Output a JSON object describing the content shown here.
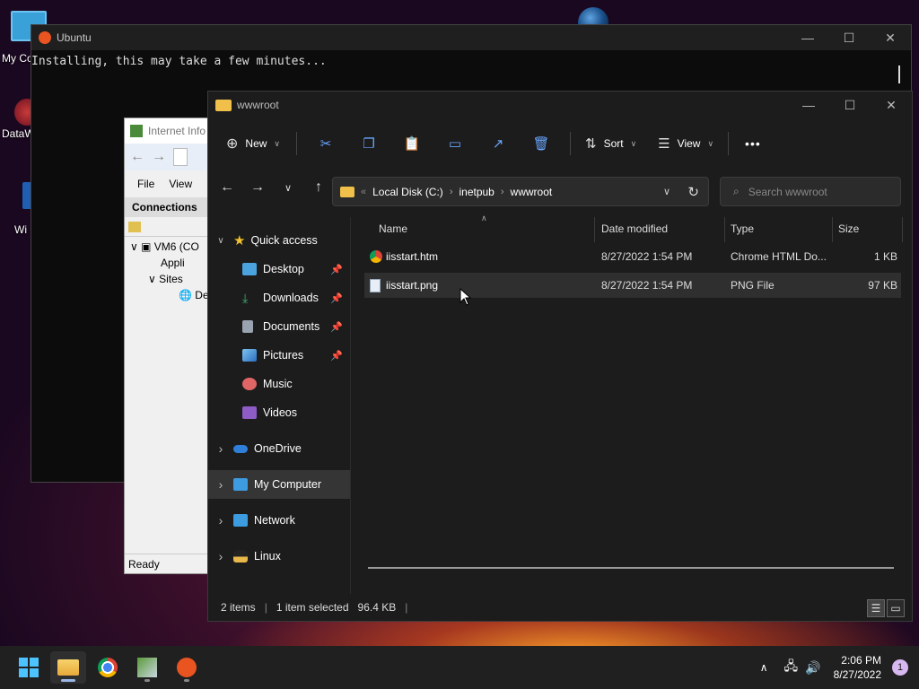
{
  "desktop": {
    "icons": [
      {
        "label": "My Co"
      },
      {
        "label": "DataW"
      },
      {
        "label": "Wi"
      }
    ]
  },
  "ubuntu": {
    "title": "Ubuntu",
    "console_line": "Installing, this may take a few minutes..."
  },
  "iis": {
    "title": "Internet Info",
    "menu": {
      "file": "File",
      "view": "View"
    },
    "connections": "Connections",
    "tree": [
      "VM6 (CO",
      "Appli",
      "Sites",
      "De"
    ],
    "status": "Ready"
  },
  "explorer": {
    "title": "wwwroot",
    "cmd": {
      "new": "New",
      "sort": "Sort",
      "view": "View",
      "more": "•••"
    },
    "address": {
      "crumbs": [
        "Local Disk (C:)",
        "inetpub",
        "wwwroot"
      ]
    },
    "search_placeholder": "Search wwwroot",
    "sidebar": [
      {
        "label": "Quick access",
        "arrow": "∨",
        "pin": "",
        "icon": "star-icon",
        "color": "#f2c12e"
      },
      {
        "label": "Desktop",
        "arrow": "",
        "pin": "📌",
        "icon": "desktop-icon",
        "color": "#4aa3df"
      },
      {
        "label": "Downloads",
        "arrow": "",
        "pin": "📌",
        "icon": "download-icon",
        "color": "#3cb371"
      },
      {
        "label": "Documents",
        "arrow": "",
        "pin": "📌",
        "icon": "document-icon",
        "color": "#9aa4b1"
      },
      {
        "label": "Pictures",
        "arrow": "",
        "pin": "📌",
        "icon": "pictures-icon",
        "color": "#4a90d9"
      },
      {
        "label": "Music",
        "arrow": "",
        "pin": "",
        "icon": "music-icon",
        "color": "#e06666"
      },
      {
        "label": "Videos",
        "arrow": "",
        "pin": "",
        "icon": "video-icon",
        "color": "#8e5cc7"
      },
      {
        "label": "OneDrive",
        "arrow": "›",
        "pin": "",
        "icon": "cloud-icon",
        "color": "#2f7fd8"
      },
      {
        "label": "My Computer",
        "arrow": "›",
        "pin": "",
        "icon": "computer-icon",
        "color": "#3d9be0"
      },
      {
        "label": "Network",
        "arrow": "›",
        "pin": "",
        "icon": "network-icon",
        "color": "#3d9be0"
      },
      {
        "label": "Linux",
        "arrow": "›",
        "pin": "",
        "icon": "penguin-icon",
        "color": "#e8b84a"
      }
    ],
    "columns": {
      "name": "Name",
      "date": "Date modified",
      "type": "Type",
      "size": "Size"
    },
    "files": [
      {
        "name": "iisstart.htm",
        "date": "8/27/2022 1:54 PM",
        "type": "Chrome HTML Do...",
        "size": "1 KB",
        "icon": "chrome-icon"
      },
      {
        "name": "iisstart.png",
        "date": "8/27/2022 1:54 PM",
        "type": "PNG File",
        "size": "97 KB",
        "icon": "image-file-icon"
      }
    ],
    "status": {
      "items": "2 items",
      "selected": "1 item selected",
      "size": "96.4 KB"
    }
  },
  "taskbar": {
    "time": "2:06 PM",
    "date": "8/27/2022",
    "notifications": "1"
  }
}
